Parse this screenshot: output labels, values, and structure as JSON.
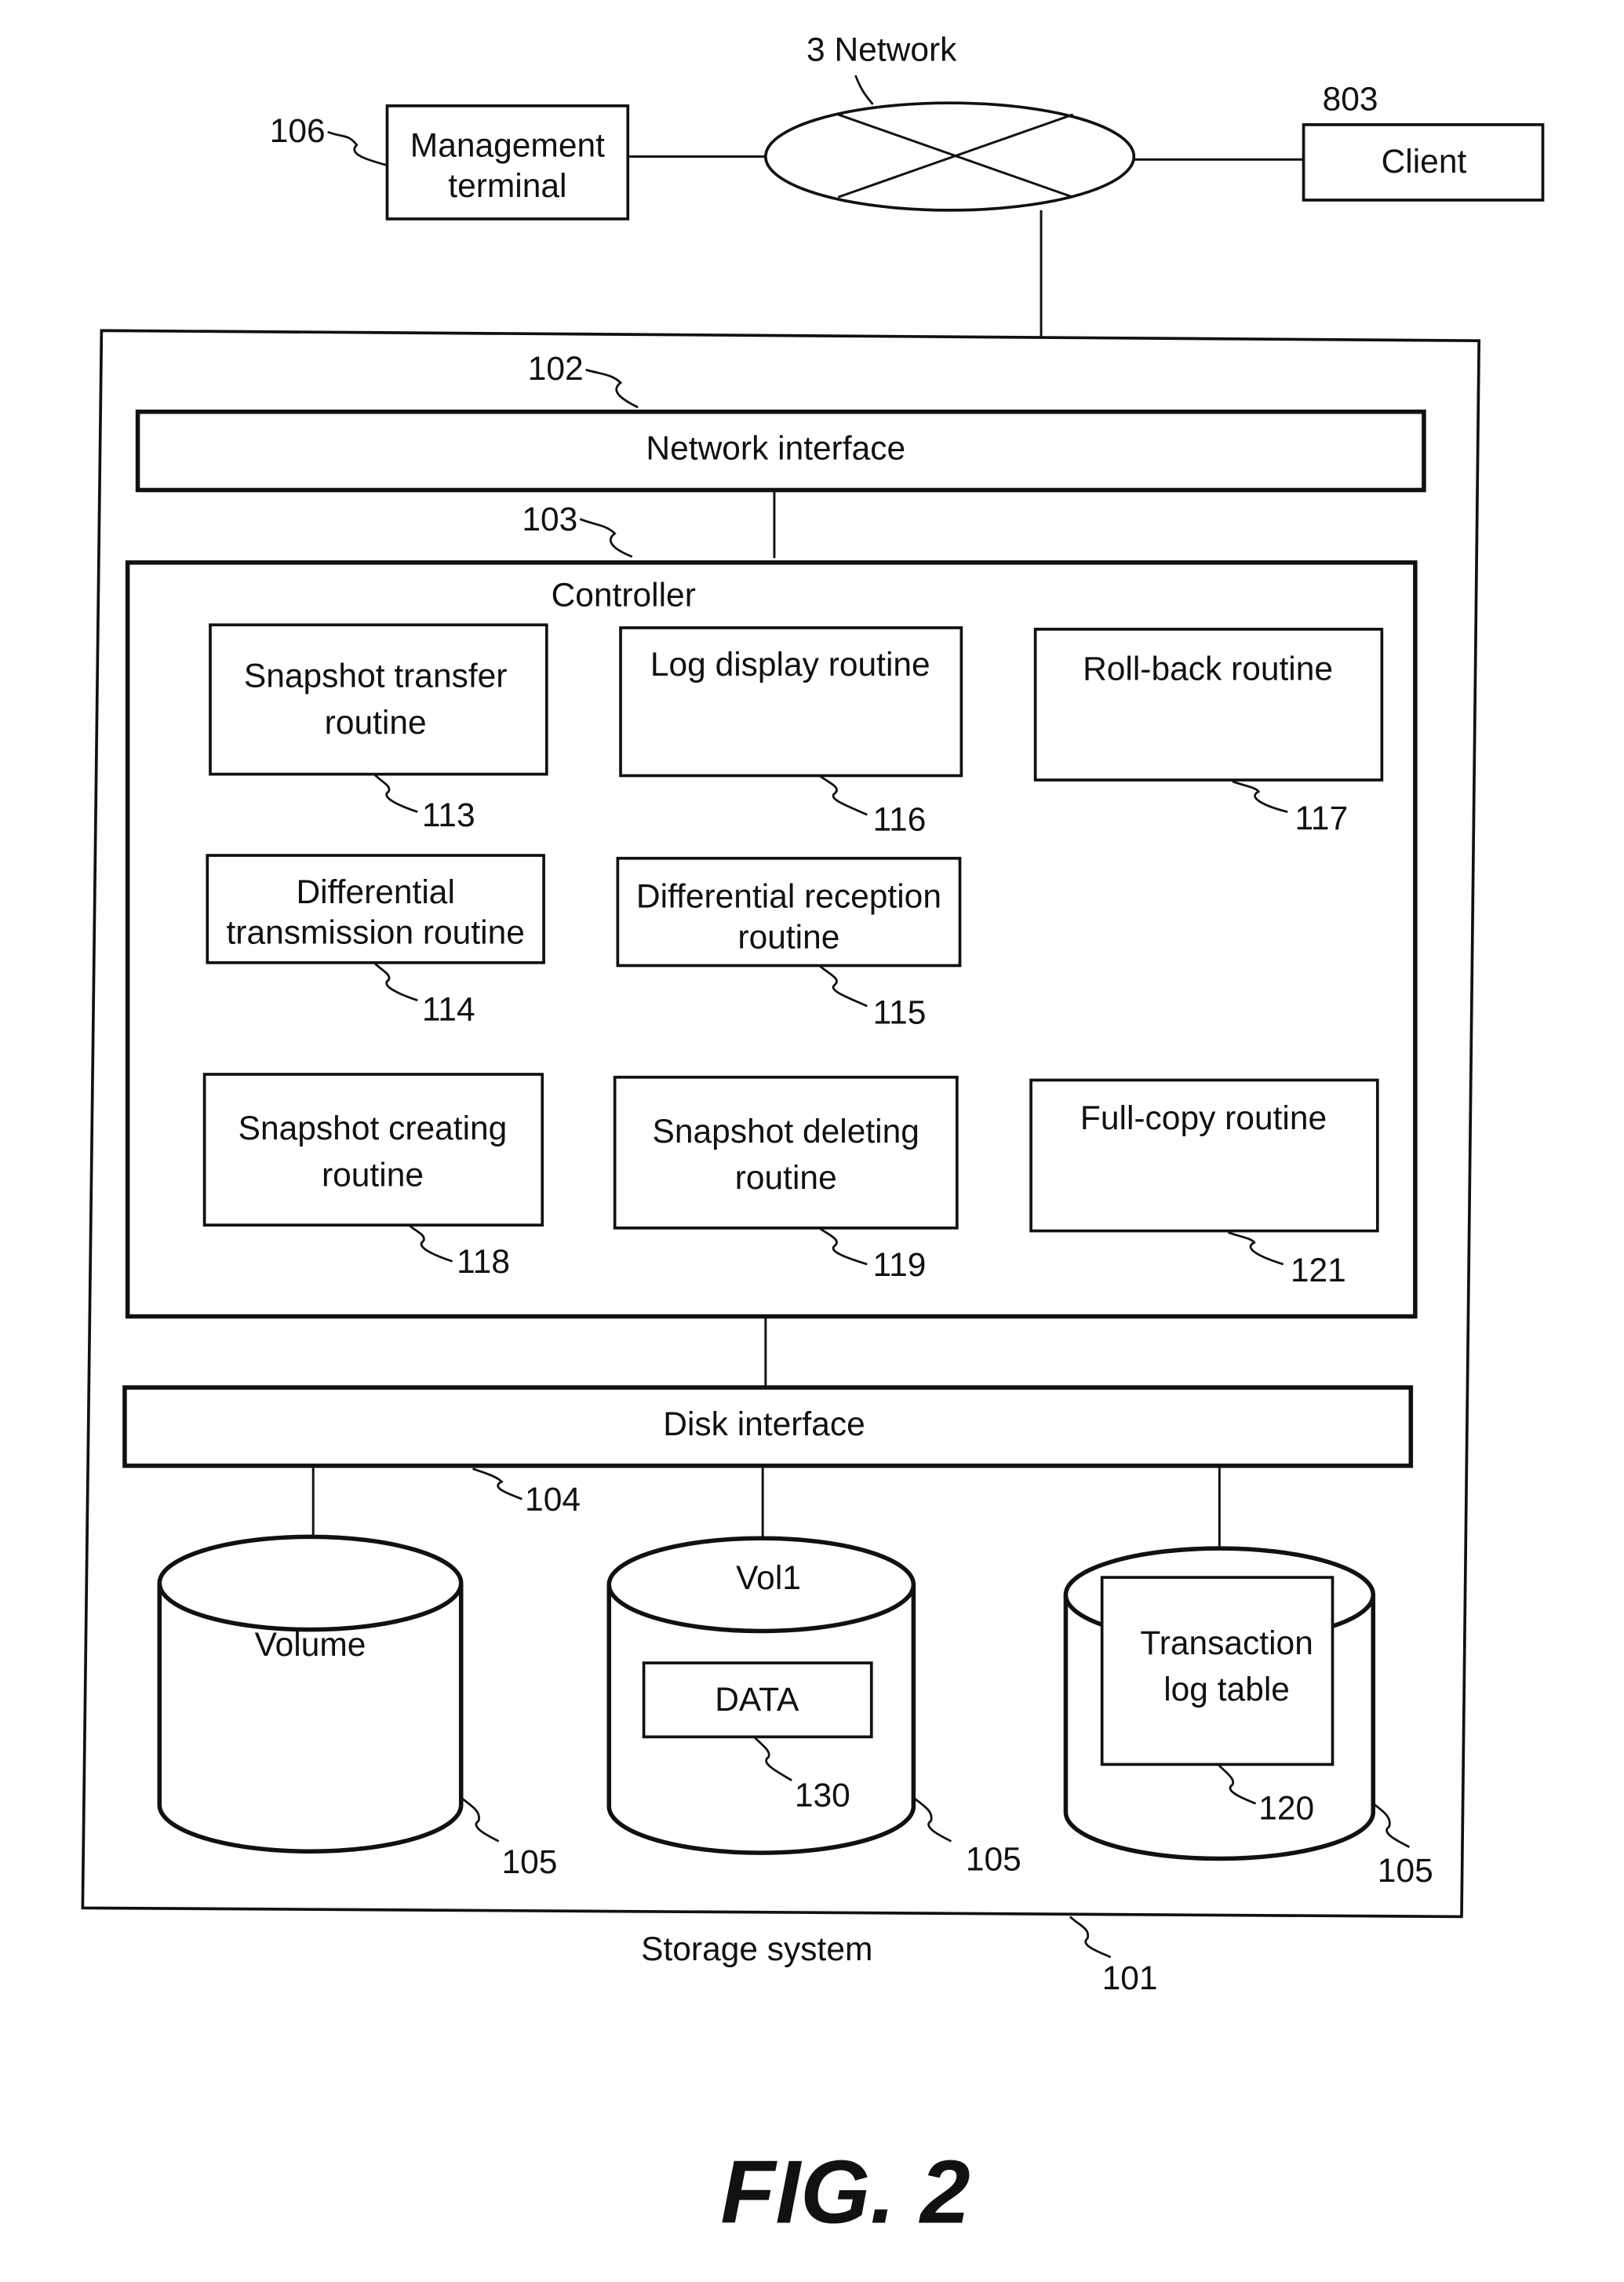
{
  "figure": {
    "caption": "FIG. 2",
    "title": "Storage system",
    "title_ref": "101"
  },
  "network": {
    "label": "3 Network",
    "management_terminal": {
      "line1": "Management",
      "line2": "terminal",
      "ref": "106"
    },
    "client": {
      "label": "Client",
      "ref": "803"
    }
  },
  "storage_system": {
    "network_interface": {
      "label": "Network interface",
      "ref": "102"
    },
    "controller": {
      "label": "Controller",
      "ref": "103",
      "routines": [
        {
          "line1": "Snapshot transfer",
          "line2": "routine",
          "ref": "113"
        },
        {
          "line1": "Log display routine",
          "line2": "",
          "ref": "116"
        },
        {
          "line1": "Roll-back routine",
          "line2": "",
          "ref": "117"
        },
        {
          "line1": "Differential",
          "line2": "transmission routine",
          "ref": "114"
        },
        {
          "line1": "Differential reception",
          "line2": "routine",
          "ref": "115"
        },
        {
          "line1": "Snapshot creating",
          "line2": "routine",
          "ref": "118"
        },
        {
          "line1": "Snapshot deleting",
          "line2": "routine",
          "ref": "119"
        },
        {
          "line1": "Full-copy routine",
          "line2": "",
          "ref": "121"
        }
      ]
    },
    "disk_interface": {
      "label": "Disk interface",
      "ref": "104"
    },
    "volumes": [
      {
        "label": "Volume",
        "ref": "105"
      },
      {
        "label": "Vol1",
        "ref": "105",
        "content": {
          "label": "DATA",
          "ref": "130"
        }
      },
      {
        "label": "",
        "ref": "105",
        "content": {
          "line1": "Transaction",
          "line2": "log table",
          "ref": "120"
        }
      }
    ]
  }
}
